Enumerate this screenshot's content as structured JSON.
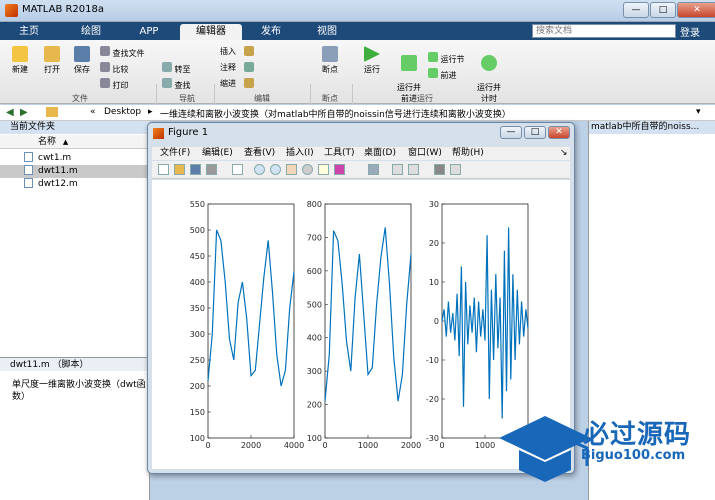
{
  "window": {
    "title": "MATLAB R2018a",
    "minimize": "—",
    "maximize": "□",
    "close": "✕"
  },
  "tabs": [
    "主页",
    "绘图",
    "APP",
    "编辑器",
    "发布",
    "视图"
  ],
  "search": {
    "placeholder": "搜索文档"
  },
  "signin": "登录",
  "ribbon": {
    "file": {
      "new": "新建",
      "open": "打开",
      "save": "保存",
      "find_files": "查找文件",
      "compare": "比较",
      "print": "打印",
      "group": "文件"
    },
    "nav": {
      "goto": "转至",
      "find": "查找",
      "group": "导航"
    },
    "edit": {
      "insert": "插入",
      "comment": "注释",
      "indent": "缩进",
      "group": "编辑"
    },
    "breakpoints": {
      "label": "断点",
      "group": "断点"
    },
    "run": {
      "run": "运行",
      "run_advance": "运行并\n前进",
      "run_section": "运行节",
      "advance": "前进",
      "run_time": "运行并\n计时",
      "group": "运行"
    }
  },
  "address": {
    "sep": "«",
    "path1": "Desktop",
    "arrow": "▸",
    "path2": "一维连续和离散小波变换（对matlab中所自带的noissin信号进行连续和离散小波变换）"
  },
  "left": {
    "header": "当前文件夹",
    "col_name": "名称",
    "col_sort": "▲",
    "files": [
      {
        "name": "cwt1.m"
      },
      {
        "name": "dwt11.m"
      },
      {
        "name": "dwt12.m"
      }
    ],
    "detail_header": "dwt11.m （脚本）",
    "detail_text": "单尺度一维离散小波变换（dwt函数）"
  },
  "right": {
    "header": "matlab中所自带的noiss..."
  },
  "figure": {
    "title": "Figure 1",
    "menu": [
      "文件(F)",
      "编辑(E)",
      "查看(V)",
      "插入(I)",
      "工具(T)",
      "桌面(D)",
      "窗口(W)",
      "帮助(H)"
    ],
    "menu_end": "↘"
  },
  "chart_data": [
    {
      "type": "line",
      "xlim": [
        0,
        4000
      ],
      "ylim": [
        100,
        550
      ],
      "yticks": [
        "550",
        "500",
        "450",
        "400",
        "350",
        "300",
        "250",
        "200",
        "150",
        "100"
      ],
      "xticks": [
        "0",
        "2000",
        "4000"
      ],
      "series": [
        {
          "x": [
            0,
            200,
            400,
            600,
            800,
            1000,
            1200,
            1400,
            1600,
            1800,
            2000,
            2200,
            2400,
            2600,
            2800,
            3000,
            3200,
            3400,
            3600,
            3800,
            4000
          ],
          "values": [
            210,
            300,
            500,
            480,
            400,
            290,
            250,
            360,
            400,
            330,
            220,
            230,
            320,
            410,
            480,
            380,
            260,
            200,
            230,
            350,
            420
          ],
          "color": "#0072bd"
        }
      ]
    },
    {
      "type": "line",
      "xlim": [
        0,
        2000
      ],
      "ylim": [
        100,
        800
      ],
      "yticks": [
        "800",
        "700",
        "600",
        "500",
        "400",
        "300",
        "200",
        "100"
      ],
      "xticks": [
        "0",
        "1000",
        "2000"
      ],
      "series": [
        {
          "x": [
            0,
            100,
            200,
            300,
            400,
            500,
            600,
            700,
            800,
            900,
            1000,
            1100,
            1200,
            1300,
            1400,
            1500,
            1600,
            1700,
            1800,
            1900,
            2000
          ],
          "values": [
            210,
            350,
            720,
            690,
            560,
            390,
            300,
            520,
            650,
            470,
            290,
            310,
            500,
            640,
            730,
            560,
            340,
            210,
            290,
            500,
            650
          ],
          "color": "#0072bd"
        }
      ]
    },
    {
      "type": "line",
      "xlim": [
        0,
        2000
      ],
      "ylim": [
        -30,
        30
      ],
      "yticks": [
        "30",
        "20",
        "10",
        "0",
        "-10",
        "-20",
        "-30"
      ],
      "xticks": [
        "0",
        "1000"
      ],
      "series": [
        {
          "name": "",
          "color": "#0072bd",
          "x": [
            0,
            50,
            100,
            150,
            200,
            250,
            300,
            350,
            400,
            450,
            500,
            550,
            600,
            650,
            700,
            750,
            800,
            850,
            900,
            950,
            1000,
            1050,
            1100,
            1150,
            1200,
            1250,
            1300,
            1350,
            1400,
            1450,
            1500,
            1550,
            1600,
            1650,
            1700,
            1750,
            1800,
            1850,
            1900,
            1950,
            2000
          ],
          "values": [
            0,
            3,
            -4,
            5,
            -3,
            2,
            -5,
            7,
            -9,
            14,
            -22,
            10,
            -6,
            4,
            -3,
            6,
            -8,
            5,
            -4,
            3,
            -5,
            22,
            -20,
            8,
            -10,
            12,
            -7,
            6,
            -25,
            18,
            -18,
            24,
            -15,
            12,
            -10,
            8,
            -6,
            5,
            -4,
            3,
            -2
          ]
        }
      ]
    }
  ],
  "logo": {
    "text": "必过源码",
    "sub": "Biguo100.com"
  }
}
